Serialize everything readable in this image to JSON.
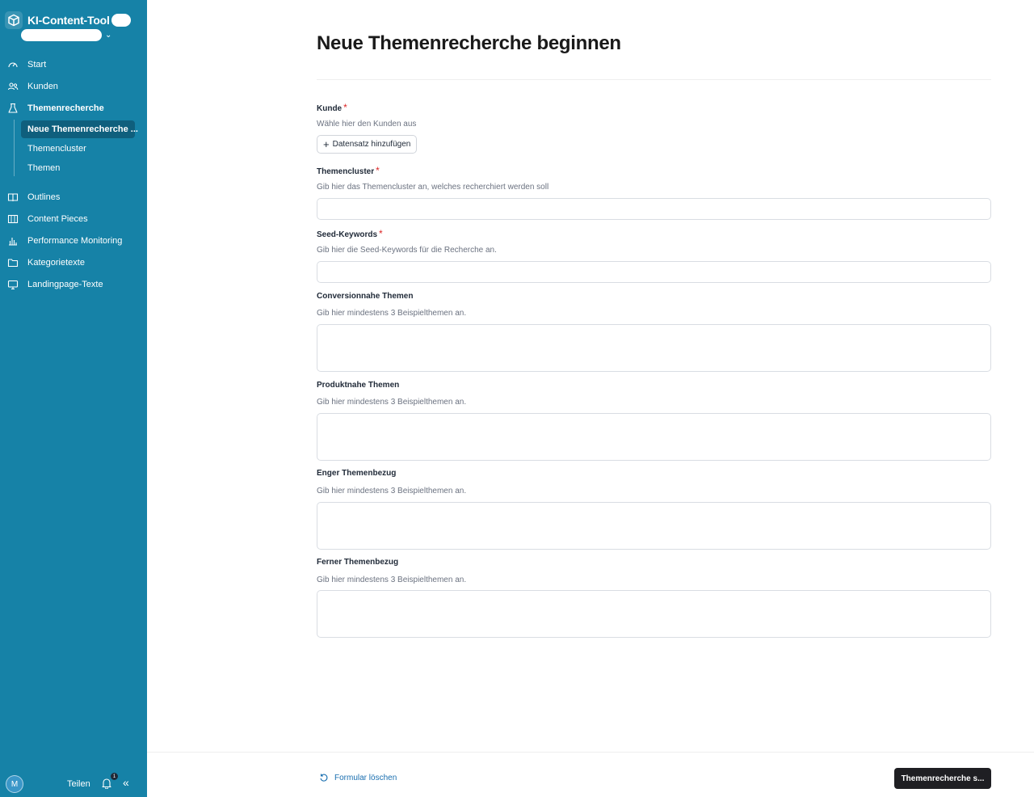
{
  "app": {
    "title": "KI-Content-Tool"
  },
  "sidebar": {
    "items": [
      {
        "label": "Start",
        "icon": "gauge-icon"
      },
      {
        "label": "Kunden",
        "icon": "users-icon"
      },
      {
        "label": "Themenrecherche",
        "icon": "flask-icon"
      },
      {
        "label": "Outlines",
        "icon": "book-open-icon"
      },
      {
        "label": "Content Pieces",
        "icon": "book-icon"
      },
      {
        "label": "Performance Monitoring",
        "icon": "bar-chart-icon"
      },
      {
        "label": "Kategorietexte",
        "icon": "folder-icon"
      },
      {
        "label": "Landingpage-Texte",
        "icon": "monitor-icon"
      }
    ],
    "subitems": [
      {
        "label": "Neue Themenrecherche ..."
      },
      {
        "label": "Themencluster"
      },
      {
        "label": "Themen"
      }
    ],
    "footer": {
      "avatar_initial": "M",
      "share_label": "Teilen",
      "notification_count": "1"
    }
  },
  "main": {
    "title": "Neue Themenrecherche beginnen",
    "fields": {
      "kunde": {
        "label": "Kunde",
        "help": "Wähle hier den Kunden aus",
        "button_label": "Datensatz hinzufügen"
      },
      "themencluster": {
        "label": "Themencluster",
        "help": "Gib hier das Themencluster an, welches recherchiert werden soll",
        "value": ""
      },
      "seed_keywords": {
        "label": "Seed-Keywords",
        "help": "Gib hier die Seed-Keywords für die Recherche an.",
        "value": ""
      },
      "conversionnahe": {
        "label": "Conversionnahe Themen",
        "help": "Gib hier mindestens 3 Beispielthemen an.",
        "value": ""
      },
      "produktnahe": {
        "label": "Produktnahe Themen",
        "help": "Gib hier mindestens 3 Beispielthemen an.",
        "value": ""
      },
      "enger": {
        "label": "Enger Themenbezug",
        "help": "Gib hier mindestens 3 Beispielthemen an.",
        "value": ""
      },
      "ferner": {
        "label": "Ferner Themenbezug",
        "help": "Gib hier mindestens 3 Beispielthemen an.",
        "value": ""
      }
    },
    "required_marker": "*",
    "footer": {
      "reset_label": "Formular löschen",
      "submit_label": "Themenrecherche s..."
    }
  },
  "colors": {
    "sidebar_bg": "#1682a7",
    "active_item_bg": "#0f5f7d",
    "required": "#dc2626",
    "submit_bg": "#1f1f23",
    "link": "#1a6fb0"
  }
}
